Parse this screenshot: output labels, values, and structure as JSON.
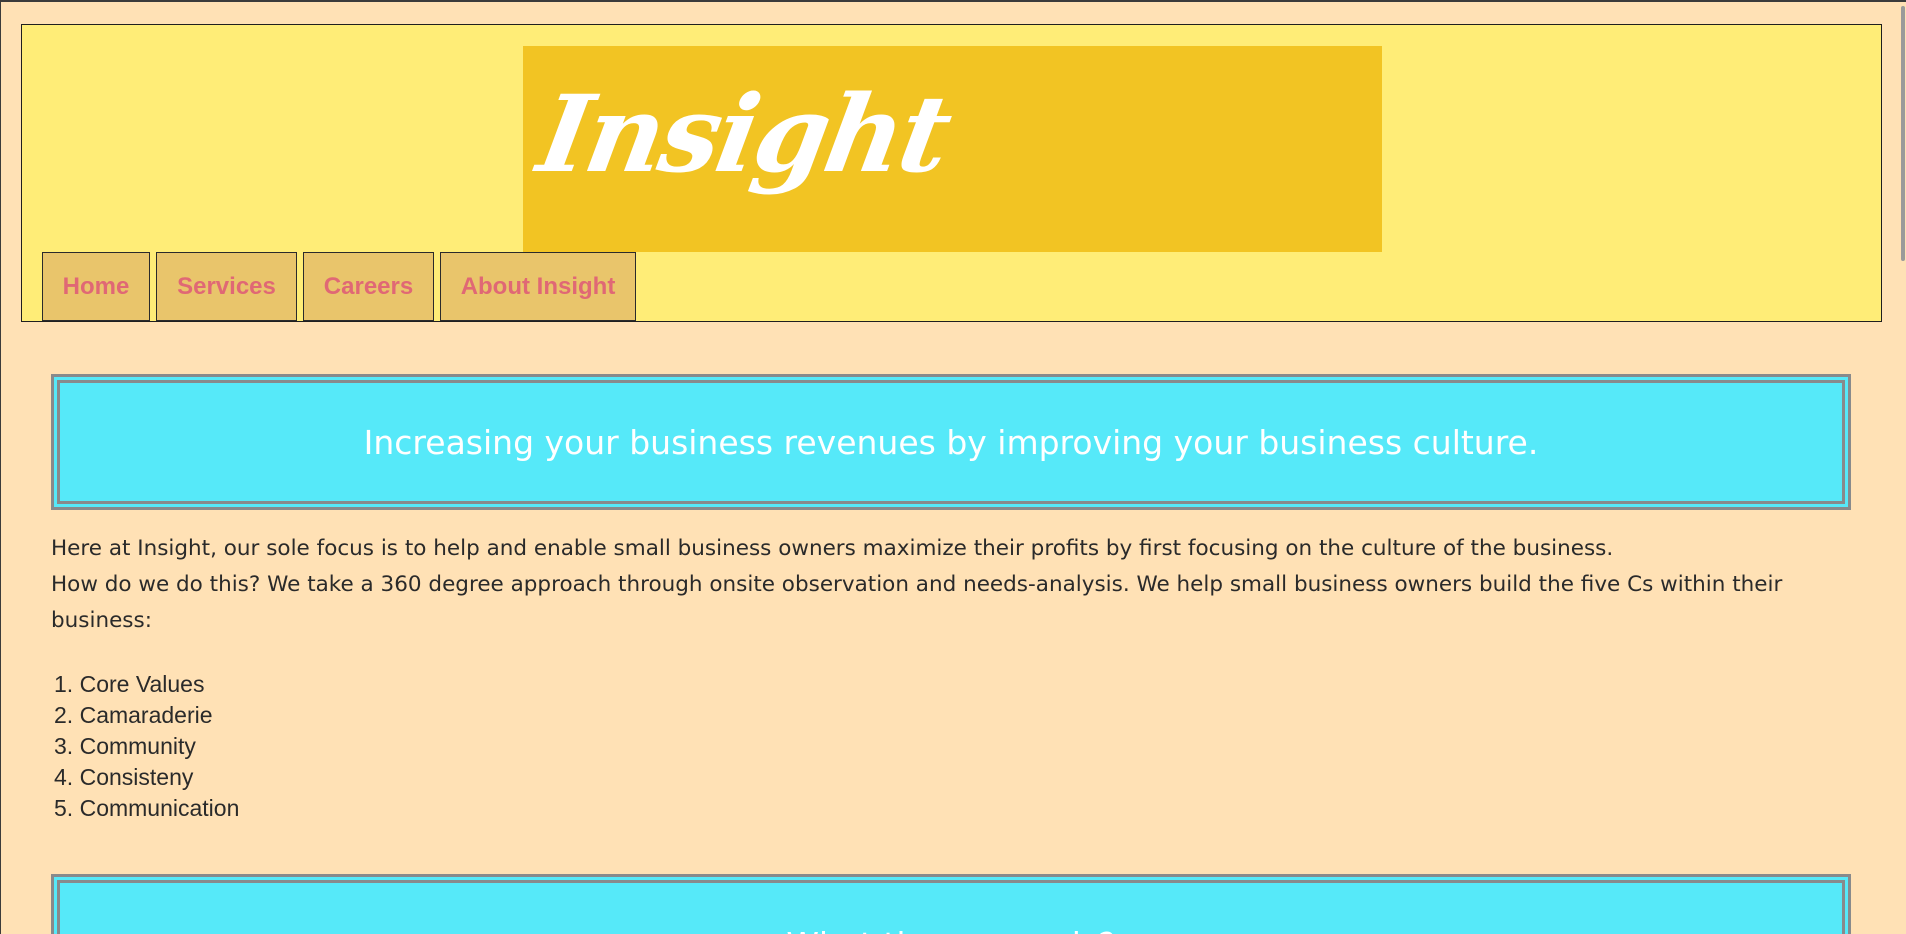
{
  "header": {
    "logo_text": "Insight"
  },
  "nav": {
    "items": [
      {
        "label": "Home"
      },
      {
        "label": "Services"
      },
      {
        "label": "Careers"
      },
      {
        "label": "About Insight"
      }
    ]
  },
  "main": {
    "banner_1": "Increasing your business revenues by improving your business culture.",
    "intro_line_1": "Here at Insight, our sole focus is to help and enable small business owners maximize their profits by first focusing on the culture of the business.",
    "intro_line_2": "How do we do this? We take a 360 degree approach through onsite observation and needs-analysis. We help small business owners build the five Cs within their business:",
    "list": [
      {
        "number": "1.",
        "label": "Core Values"
      },
      {
        "number": "2.",
        "label": "Camaraderie"
      },
      {
        "number": "3.",
        "label": "Community"
      },
      {
        "number": "4.",
        "label": "Consisteny"
      },
      {
        "number": "5.",
        "label": "Communication"
      }
    ],
    "banner_2": "What the money is?"
  },
  "colors": {
    "page_bg": "#ffe1b5",
    "header_bg": "#ffed77",
    "logo_bg": "#f2c423",
    "nav_bg": "#e9c56b",
    "nav_text": "#e06875",
    "banner_bg": "#56e9f9",
    "banner_border": "#888a8c"
  }
}
